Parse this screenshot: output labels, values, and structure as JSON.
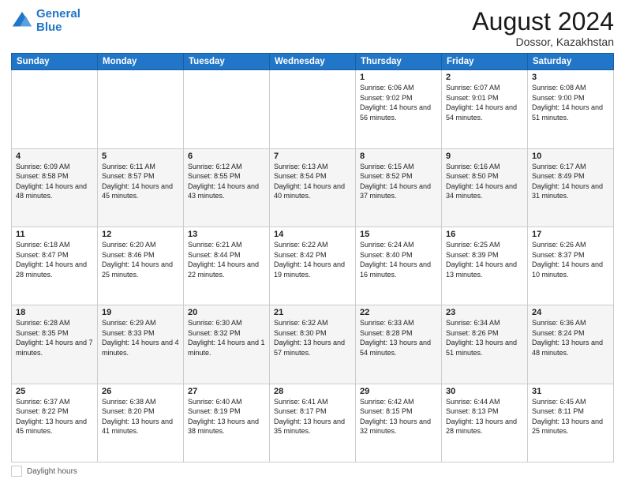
{
  "header": {
    "logo_line1": "General",
    "logo_line2": "Blue",
    "month_year": "August 2024",
    "location": "Dossor, Kazakhstan"
  },
  "days_of_week": [
    "Sunday",
    "Monday",
    "Tuesday",
    "Wednesday",
    "Thursday",
    "Friday",
    "Saturday"
  ],
  "footer": {
    "label": "Daylight hours"
  },
  "weeks": [
    {
      "days": [
        {
          "num": "",
          "info": ""
        },
        {
          "num": "",
          "info": ""
        },
        {
          "num": "",
          "info": ""
        },
        {
          "num": "",
          "info": ""
        },
        {
          "num": "1",
          "info": "Sunrise: 6:06 AM\nSunset: 9:02 PM\nDaylight: 14 hours\nand 56 minutes."
        },
        {
          "num": "2",
          "info": "Sunrise: 6:07 AM\nSunset: 9:01 PM\nDaylight: 14 hours\nand 54 minutes."
        },
        {
          "num": "3",
          "info": "Sunrise: 6:08 AM\nSunset: 9:00 PM\nDaylight: 14 hours\nand 51 minutes."
        }
      ]
    },
    {
      "days": [
        {
          "num": "4",
          "info": "Sunrise: 6:09 AM\nSunset: 8:58 PM\nDaylight: 14 hours\nand 48 minutes."
        },
        {
          "num": "5",
          "info": "Sunrise: 6:11 AM\nSunset: 8:57 PM\nDaylight: 14 hours\nand 45 minutes."
        },
        {
          "num": "6",
          "info": "Sunrise: 6:12 AM\nSunset: 8:55 PM\nDaylight: 14 hours\nand 43 minutes."
        },
        {
          "num": "7",
          "info": "Sunrise: 6:13 AM\nSunset: 8:54 PM\nDaylight: 14 hours\nand 40 minutes."
        },
        {
          "num": "8",
          "info": "Sunrise: 6:15 AM\nSunset: 8:52 PM\nDaylight: 14 hours\nand 37 minutes."
        },
        {
          "num": "9",
          "info": "Sunrise: 6:16 AM\nSunset: 8:50 PM\nDaylight: 14 hours\nand 34 minutes."
        },
        {
          "num": "10",
          "info": "Sunrise: 6:17 AM\nSunset: 8:49 PM\nDaylight: 14 hours\nand 31 minutes."
        }
      ]
    },
    {
      "days": [
        {
          "num": "11",
          "info": "Sunrise: 6:18 AM\nSunset: 8:47 PM\nDaylight: 14 hours\nand 28 minutes."
        },
        {
          "num": "12",
          "info": "Sunrise: 6:20 AM\nSunset: 8:46 PM\nDaylight: 14 hours\nand 25 minutes."
        },
        {
          "num": "13",
          "info": "Sunrise: 6:21 AM\nSunset: 8:44 PM\nDaylight: 14 hours\nand 22 minutes."
        },
        {
          "num": "14",
          "info": "Sunrise: 6:22 AM\nSunset: 8:42 PM\nDaylight: 14 hours\nand 19 minutes."
        },
        {
          "num": "15",
          "info": "Sunrise: 6:24 AM\nSunset: 8:40 PM\nDaylight: 14 hours\nand 16 minutes."
        },
        {
          "num": "16",
          "info": "Sunrise: 6:25 AM\nSunset: 8:39 PM\nDaylight: 14 hours\nand 13 minutes."
        },
        {
          "num": "17",
          "info": "Sunrise: 6:26 AM\nSunset: 8:37 PM\nDaylight: 14 hours\nand 10 minutes."
        }
      ]
    },
    {
      "days": [
        {
          "num": "18",
          "info": "Sunrise: 6:28 AM\nSunset: 8:35 PM\nDaylight: 14 hours\nand 7 minutes."
        },
        {
          "num": "19",
          "info": "Sunrise: 6:29 AM\nSunset: 8:33 PM\nDaylight: 14 hours\nand 4 minutes."
        },
        {
          "num": "20",
          "info": "Sunrise: 6:30 AM\nSunset: 8:32 PM\nDaylight: 14 hours\nand 1 minute."
        },
        {
          "num": "21",
          "info": "Sunrise: 6:32 AM\nSunset: 8:30 PM\nDaylight: 13 hours\nand 57 minutes."
        },
        {
          "num": "22",
          "info": "Sunrise: 6:33 AM\nSunset: 8:28 PM\nDaylight: 13 hours\nand 54 minutes."
        },
        {
          "num": "23",
          "info": "Sunrise: 6:34 AM\nSunset: 8:26 PM\nDaylight: 13 hours\nand 51 minutes."
        },
        {
          "num": "24",
          "info": "Sunrise: 6:36 AM\nSunset: 8:24 PM\nDaylight: 13 hours\nand 48 minutes."
        }
      ]
    },
    {
      "days": [
        {
          "num": "25",
          "info": "Sunrise: 6:37 AM\nSunset: 8:22 PM\nDaylight: 13 hours\nand 45 minutes."
        },
        {
          "num": "26",
          "info": "Sunrise: 6:38 AM\nSunset: 8:20 PM\nDaylight: 13 hours\nand 41 minutes."
        },
        {
          "num": "27",
          "info": "Sunrise: 6:40 AM\nSunset: 8:19 PM\nDaylight: 13 hours\nand 38 minutes."
        },
        {
          "num": "28",
          "info": "Sunrise: 6:41 AM\nSunset: 8:17 PM\nDaylight: 13 hours\nand 35 minutes."
        },
        {
          "num": "29",
          "info": "Sunrise: 6:42 AM\nSunset: 8:15 PM\nDaylight: 13 hours\nand 32 minutes."
        },
        {
          "num": "30",
          "info": "Sunrise: 6:44 AM\nSunset: 8:13 PM\nDaylight: 13 hours\nand 28 minutes."
        },
        {
          "num": "31",
          "info": "Sunrise: 6:45 AM\nSunset: 8:11 PM\nDaylight: 13 hours\nand 25 minutes."
        }
      ]
    }
  ]
}
